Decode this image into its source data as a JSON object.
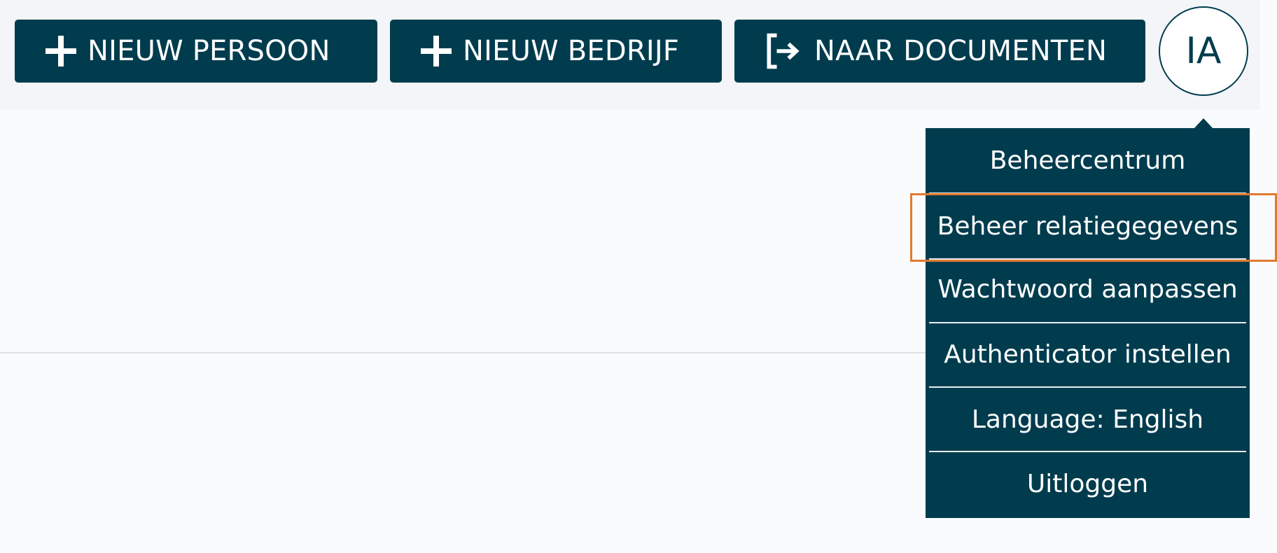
{
  "toolbar": {
    "new_person_label": "NIEUW PERSOON",
    "new_company_label": "NIEUW BEDRIJF",
    "to_documents_label": "NAAR DOCUMENTEN"
  },
  "user": {
    "initials": "IA"
  },
  "user_menu": {
    "items": [
      {
        "label": "Beheercentrum"
      },
      {
        "label": "Beheer relatiegegevens"
      },
      {
        "label": "Wachtwoord aanpassen"
      },
      {
        "label": "Authenticator instellen"
      },
      {
        "label": "Language: English"
      },
      {
        "label": "Uitloggen"
      }
    ]
  },
  "icons": {
    "new_person": "plus-icon",
    "new_company": "plus-icon",
    "to_documents": "exit-arrow-icon"
  },
  "colors": {
    "primary": "#003c4e",
    "page_background": "#fafbfd",
    "topbar_background": "#f3f5f8",
    "highlight": "#e07a2f",
    "text_on_primary": "#ffffff"
  }
}
